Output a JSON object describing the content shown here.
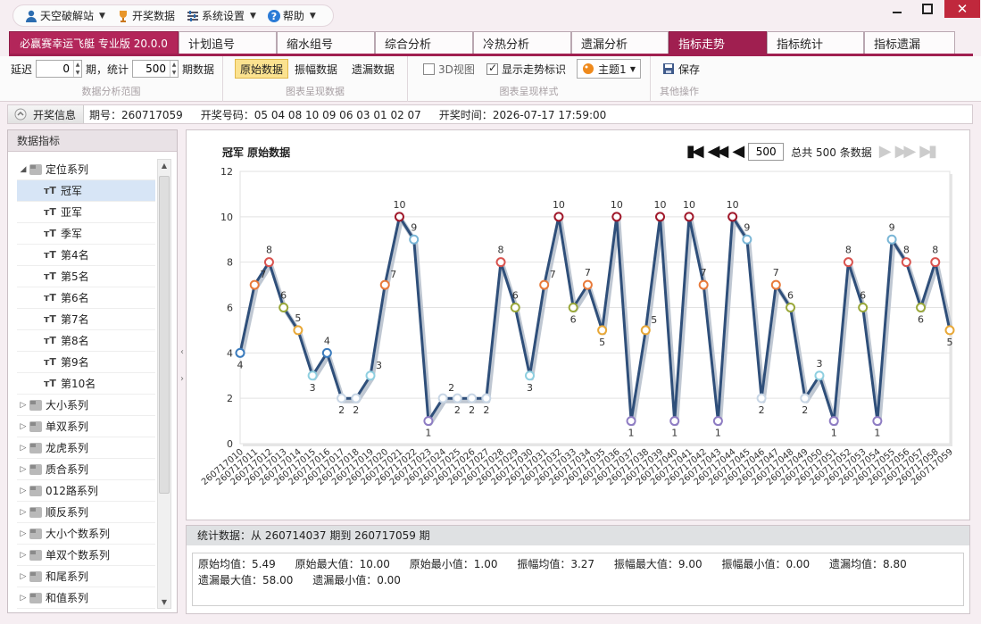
{
  "menu": {
    "items": [
      {
        "label": "天空破解站",
        "icon": "user-icon",
        "dropdown": true
      },
      {
        "label": "开奖数据",
        "icon": "trophy-icon",
        "dropdown": false
      },
      {
        "label": "系统设置",
        "icon": "settings-icon",
        "dropdown": true
      },
      {
        "label": "帮助",
        "icon": "help-icon",
        "dropdown": true
      }
    ]
  },
  "tabs": {
    "brand": "必赢赛幸运飞艇 专业版 20.0.0",
    "items": [
      "计划追号",
      "缩水组号",
      "综合分析",
      "冷热分析",
      "遗漏分析",
      "指标走势",
      "指标统计",
      "指标遗漏"
    ],
    "active": "指标走势"
  },
  "ribbon": {
    "delay_label": "延迟",
    "delay_value": "0",
    "period_label": "期，统计",
    "count_value": "500",
    "count_suffix": "期数据",
    "group1_caption": "数据分析范围",
    "btn_raw": "原始数据",
    "btn_amplitude": "振幅数据",
    "btn_missing": "遗漏数据",
    "group2_caption": "图表呈现数据",
    "view3d": "3D视图",
    "show_marker": "显示走势标识",
    "theme": "主题1",
    "group3_caption": "图表呈现样式",
    "save": "保存",
    "group4_caption": "其他操作"
  },
  "info": {
    "button": "开奖信息",
    "period_label": "期号：",
    "period": "260717059",
    "numbers_label": "开奖号码：",
    "numbers": "05 04 08 10 09 06 03 01 02 07",
    "time_label": "开奖时间：",
    "time": "2026-07-17 17:59:00"
  },
  "sidebar": {
    "header": "数据指标",
    "groups": [
      {
        "label": "定位系列",
        "expanded": true,
        "children": [
          "冠军",
          "亚军",
          "季军",
          "第4名",
          "第5名",
          "第6名",
          "第7名",
          "第8名",
          "第9名",
          "第10名"
        ]
      },
      {
        "label": "大小系列"
      },
      {
        "label": "单双系列"
      },
      {
        "label": "龙虎系列"
      },
      {
        "label": "质合系列"
      },
      {
        "label": "012路系列"
      },
      {
        "label": "顺反系列"
      },
      {
        "label": "大小个数系列"
      },
      {
        "label": "单双个数系列"
      },
      {
        "label": "和尾系列"
      },
      {
        "label": "和值系列"
      }
    ],
    "selected": "冠军"
  },
  "chart_header": {
    "title": "冠军 原始数据",
    "page_value": "500",
    "total_text": "总共 500 条数据"
  },
  "chart_data": {
    "type": "line",
    "title": "冠军 原始数据",
    "xlabel": "",
    "ylabel": "",
    "ylim": [
      0,
      12
    ],
    "yticks": [
      0,
      2,
      4,
      6,
      8,
      10,
      12
    ],
    "grid": true,
    "categories": [
      "260717010",
      "260717011",
      "260717012",
      "260717013",
      "260717014",
      "260717015",
      "260717016",
      "260717017",
      "260717018",
      "260717019",
      "260717020",
      "260717021",
      "260717022",
      "260717023",
      "260717024",
      "260717025",
      "260717026",
      "260717027",
      "260717028",
      "260717029",
      "260717030",
      "260717031",
      "260717032",
      "260717033",
      "260717034",
      "260717035",
      "260717036",
      "260717037",
      "260717038",
      "260717039",
      "260717040",
      "260717041",
      "260717042",
      "260717043",
      "260717044",
      "260717045",
      "260717046",
      "260717047",
      "260717048",
      "260717049",
      "260717050",
      "260717051",
      "260717052",
      "260717053",
      "260717054",
      "260717055",
      "260717056",
      "260717057",
      "260717058",
      "260717059"
    ],
    "values": [
      4,
      7,
      8,
      6,
      5,
      3,
      4,
      2,
      2,
      3,
      7,
      10,
      9,
      1,
      2,
      2,
      2,
      2,
      8,
      6,
      3,
      7,
      10,
      6,
      7,
      5,
      10,
      1,
      5,
      10,
      1,
      10,
      7,
      1,
      10,
      9,
      2,
      7,
      6,
      2,
      3,
      1,
      8,
      6,
      1,
      9,
      8,
      6,
      8,
      5
    ],
    "line_color": "#2f4f7a",
    "marker_colors": {
      "1": "#8e7cc3",
      "2": "#c8d6e5",
      "3": "#8ecfe0",
      "4": "#3a7bbd",
      "5": "#e8a838",
      "6": "#9aa83a",
      "7": "#e87a3a",
      "8": "#d9534f",
      "9": "#7ab6d6",
      "10": "#a0182a"
    }
  },
  "stats": {
    "header": "统计数据：从 260714037 期到 260717059 期",
    "items": [
      "原始均值：5.49",
      "原始最大值：10.00",
      "原始最小值：1.00",
      "振幅均值：3.27",
      "振幅最大值：9.00",
      "振幅最小值：0.00",
      "遗漏均值：8.80",
      "遗漏最大值：58.00",
      "遗漏最小值：0.00"
    ]
  }
}
